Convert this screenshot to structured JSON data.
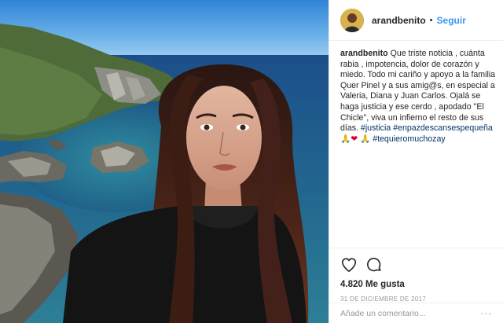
{
  "post": {
    "username": "arandbenito",
    "follow_label": "Seguir",
    "separator": "•",
    "caption": {
      "username": "arandbenito",
      "text": "Que triste noticia , cuánta rabia , impotencia, dolor de corazón y miedo. Todo mi cariño y apoyo a la familia Quer Pinel y a sus amig@s, en especial a Valeria, Diana y Juan Carlos. Ojalá se haga justicia y ese cerdo , apodado \"El Chicle\", viva un infierno el resto de sus días.",
      "hashtag1": "#justicia",
      "hashtag2": "#enpazdescansespequeña",
      "emoji1": "🙏",
      "emoji2": "❤",
      "emoji3": "🙏",
      "hashtag3": "#tequieromuchozay"
    },
    "likes": "4.820 Me gusta",
    "date": "31 DE DICIEMBRE DE 2017",
    "comment_placeholder": "Añade un comentario...",
    "more_label": "···"
  },
  "icons": {
    "like": "heart-icon",
    "comment": "comment-icon",
    "avatar": "profile-avatar"
  },
  "colors": {
    "link_blue": "#3897f0",
    "hashtag": "#003569",
    "heart_red": "#e0002a"
  }
}
